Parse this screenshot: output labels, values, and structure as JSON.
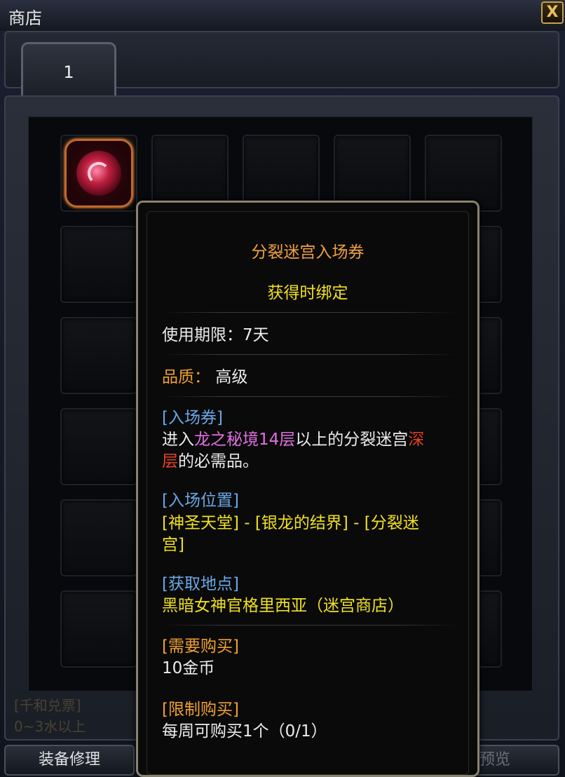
{
  "window": {
    "title": "商店",
    "close_label": "X"
  },
  "tabs": [
    {
      "label": "1"
    }
  ],
  "bottom": {
    "repair_button": "装备修理",
    "preview_button": "预览",
    "faded_lines": [
      "[千和兑票]",
      "0~3水以上"
    ]
  },
  "tooltip": {
    "item_name": "分裂迷宫入场券",
    "bind": "获得时绑定",
    "duration": "使用期限：7天",
    "quality_label": "品质：",
    "quality_value": "高级",
    "desc_header": "[入场券]",
    "desc_1": "进入",
    "desc_2": "龙之秘境14层",
    "desc_3": "以上的分裂迷宫",
    "desc_4": "深",
    "desc_5": "层",
    "desc_6": "的必需品。",
    "location_header": "[入场位置]",
    "location_line1": "[神圣天堂] - [银龙的结界] - [分裂迷",
    "location_line2": "宫]",
    "obtain_header": "[获取地点]",
    "obtain_value": "黑暗女神官格里西亚（迷宫商店）",
    "price_header": "[需要购买]",
    "price_value": "10金币",
    "limit_header": "[限制购买]",
    "limit_value": "每周可购买1个（0/1）"
  }
}
